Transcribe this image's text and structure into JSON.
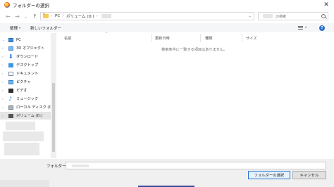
{
  "window": {
    "title": "フォルダーの選択",
    "close_glyph": "✕"
  },
  "nav": {
    "back_glyph": "←",
    "forward_glyph": "→",
    "recent_glyph": "⌄",
    "up_glyph": "↑"
  },
  "address": {
    "crumbs": [
      "PC",
      "ボリューム (D:)"
    ],
    "separator": "›",
    "dropdown_glyph": "⌄"
  },
  "search": {
    "placeholder": "の検索"
  },
  "toolbar": {
    "organize_label": "整理",
    "organize_dd": "▾",
    "new_folder_label": "新しいフォルダー",
    "view_dd": "▾",
    "help_glyph": "?"
  },
  "sidebar": {
    "items": [
      {
        "label": "PC",
        "icon": "pc-icon",
        "expand": "⌄"
      },
      {
        "label": "3D オブジェクト",
        "icon": "3d-objects-icon",
        "expand": "›"
      },
      {
        "label": "ダウンロード",
        "icon": "download-icon",
        "glyph": "⬇",
        "expand": "›"
      },
      {
        "label": "デスクトップ",
        "icon": "desktop-icon",
        "expand": "›"
      },
      {
        "label": "ドキュメント",
        "icon": "document-icon",
        "expand": "›"
      },
      {
        "label": "ピクチャ",
        "icon": "picture-icon",
        "expand": "›"
      },
      {
        "label": "ビデオ",
        "icon": "video-icon",
        "expand": "›"
      },
      {
        "label": "ミュージック",
        "icon": "music-icon",
        "glyph": "♪",
        "expand": "›"
      },
      {
        "label": "ローカル ディスク (C",
        "icon": "local-disk-icon",
        "expand": "›"
      },
      {
        "label": "ボリューム (D:)",
        "icon": "volume-icon",
        "expand": "›",
        "selected": true
      }
    ]
  },
  "columns": [
    "名前",
    "更新日時",
    "種類",
    "サイズ"
  ],
  "sort_glyph": "⌃",
  "empty_message": "検索条件に一致する項目はありません。",
  "footer": {
    "folder_label": "フォルダー:",
    "select_button": "フォルダーの選択",
    "cancel_button": "キャンセル"
  },
  "colors": {
    "accent": "#2a76d2",
    "selected_bg": "#e5e5e5",
    "help": "#2f6fce"
  }
}
